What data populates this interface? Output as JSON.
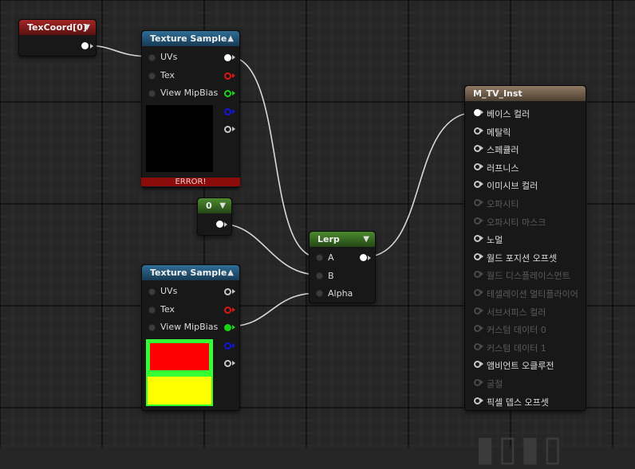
{
  "nodes": {
    "texcoord": {
      "title": "TexCoord[0]"
    },
    "texsample1": {
      "title": "Texture Sample",
      "pins": [
        "UVs",
        "Tex",
        "View MipBias"
      ],
      "error": "ERROR!"
    },
    "texsample2": {
      "title": "Texture Sample",
      "pins": [
        "UVs",
        "Tex",
        "View MipBias"
      ]
    },
    "constant": {
      "title": "0"
    },
    "lerp": {
      "title": "Lerp",
      "pins": [
        "A",
        "B",
        "Alpha"
      ]
    },
    "material": {
      "title": "M_TV_Inst",
      "pins": [
        {
          "label": "베이스 컬러",
          "enabled": true
        },
        {
          "label": "메탈릭",
          "enabled": true
        },
        {
          "label": "스페큘러",
          "enabled": true
        },
        {
          "label": "러프니스",
          "enabled": true
        },
        {
          "label": "이미시브 컬러",
          "enabled": true
        },
        {
          "label": "오파시티",
          "enabled": false
        },
        {
          "label": "오파시티 마스크",
          "enabled": false
        },
        {
          "label": "노멀",
          "enabled": true
        },
        {
          "label": "월드 포지션 오프셋",
          "enabled": true
        },
        {
          "label": "월드 디스플레이스먼트",
          "enabled": false
        },
        {
          "label": "테셀레이션 멀티플라이어",
          "enabled": false
        },
        {
          "label": "서브서피스 컬러",
          "enabled": false
        },
        {
          "label": "커스텀 데이터 0",
          "enabled": false
        },
        {
          "label": "커스텀 데이터 1",
          "enabled": false
        },
        {
          "label": "앰비언트 오클루전",
          "enabled": true
        },
        {
          "label": "굴절",
          "enabled": false
        },
        {
          "label": "픽셀 뎁스 오프셋",
          "enabled": true
        }
      ]
    }
  },
  "colors": {
    "background": "#262626",
    "red_channel": "#e01515",
    "green_channel": "#17d417",
    "blue_channel": "#1515e0",
    "preview_red": "#ff0000",
    "preview_yellow": "#ffff00",
    "preview_border": "#33ff33"
  },
  "icons": {
    "collapse": "triangle-up-icon",
    "expand": "triangle-down-icon"
  }
}
